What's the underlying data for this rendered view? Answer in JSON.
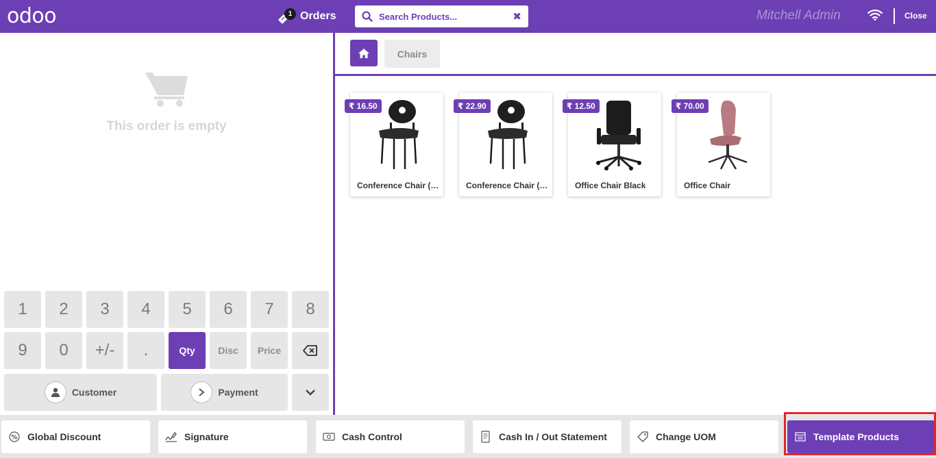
{
  "header": {
    "logo": "odoo",
    "orders_label": "Orders",
    "orders_count": "1",
    "search_placeholder": "Search Products...",
    "user_name": "Mitchell Admin",
    "close_label": "Close"
  },
  "order": {
    "empty_text": "This order is empty"
  },
  "numpad": {
    "row1": [
      "1",
      "2",
      "3",
      "4",
      "5",
      "6",
      "7",
      "8"
    ],
    "row2": [
      "9",
      "0",
      "+/-",
      ".",
      "Qty",
      "Disc",
      "Price"
    ],
    "active_mode": "Qty",
    "customer_label": "Customer",
    "payment_label": "Payment"
  },
  "categories": {
    "breadcrumb": "Chairs"
  },
  "products": [
    {
      "price": "₹ 16.50",
      "name": "Conference Chair (Steel)"
    },
    {
      "price": "₹ 22.90",
      "name": "Conference Chair (Aluminium)"
    },
    {
      "price": "₹ 12.50",
      "name": "Office Chair Black"
    },
    {
      "price": "₹ 70.00",
      "name": "Office Chair"
    }
  ],
  "control_buttons": [
    {
      "label": "Global Discount",
      "icon": "percent-icon"
    },
    {
      "label": "Signature",
      "icon": "signature-icon"
    },
    {
      "label": "Cash Control",
      "icon": "money-icon"
    },
    {
      "label": "Cash In / Out Statement",
      "icon": "receipt-icon"
    },
    {
      "label": "Change UOM",
      "icon": "tag-icon"
    },
    {
      "label": "Template Products",
      "icon": "list-icon"
    }
  ],
  "colors": {
    "brand": "#6c3fb5",
    "highlight": "#e0262d"
  }
}
